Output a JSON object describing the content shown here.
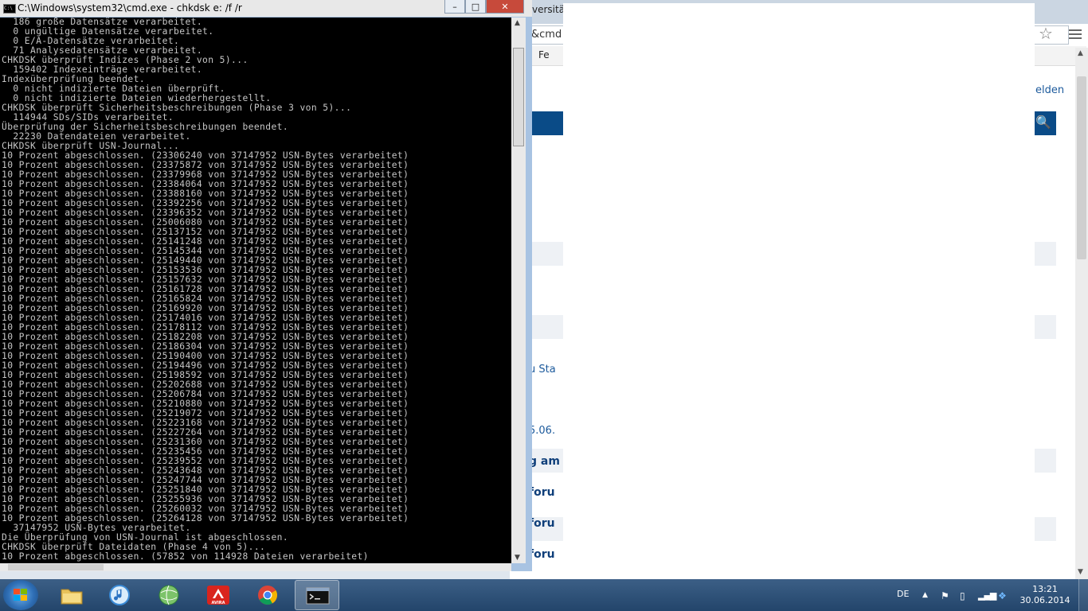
{
  "browser": {
    "tab_title_fragment": "versität",
    "address_fragment": "&cmd",
    "bookmark_fragment": "Fe",
    "login_fragment": "elden",
    "snippets": [
      "u Sta",
      "5.06.",
      "g am",
      "foru",
      "foru",
      "foru"
    ]
  },
  "cmd": {
    "title": "C:\\Windows\\system32\\cmd.exe - chkdsk  e: /f /r",
    "minimize": "–",
    "maximize": "□",
    "close": "✕",
    "lines": [
      "  186 große Datensätze verarbeitet.",
      "  0 ungültige Datensätze verarbeitet.",
      "  0 E/A-Datensätze verarbeitet.",
      "  71 Analysedatensätze verarbeitet.",
      "CHKDSK überprüft Indizes (Phase 2 von 5)...",
      "  159402 Indexeinträge verarbeitet.",
      "Indexüberprüfung beendet.",
      "  0 nicht indizierte Dateien überprüft.",
      "  0 nicht indizierte Dateien wiederhergestellt.",
      "CHKDSK überprüft Sicherheitsbeschreibungen (Phase 3 von 5)...",
      "  114944 SDs/SIDs verarbeitet.",
      "Überprüfung der Sicherheitsbeschreibungen beendet.",
      "  22230 Datendateien verarbeitet.",
      "CHKDSK überprüft USN-Journal...",
      "10 Prozent abgeschlossen. (23306240 von 37147952 USN-Bytes verarbeitet)",
      "10 Prozent abgeschlossen. (23375872 von 37147952 USN-Bytes verarbeitet)",
      "10 Prozent abgeschlossen. (23379968 von 37147952 USN-Bytes verarbeitet)",
      "10 Prozent abgeschlossen. (23384064 von 37147952 USN-Bytes verarbeitet)",
      "10 Prozent abgeschlossen. (23388160 von 37147952 USN-Bytes verarbeitet)",
      "10 Prozent abgeschlossen. (23392256 von 37147952 USN-Bytes verarbeitet)",
      "10 Prozent abgeschlossen. (23396352 von 37147952 USN-Bytes verarbeitet)",
      "10 Prozent abgeschlossen. (25006080 von 37147952 USN-Bytes verarbeitet)",
      "10 Prozent abgeschlossen. (25137152 von 37147952 USN-Bytes verarbeitet)",
      "10 Prozent abgeschlossen. (25141248 von 37147952 USN-Bytes verarbeitet)",
      "10 Prozent abgeschlossen. (25145344 von 37147952 USN-Bytes verarbeitet)",
      "10 Prozent abgeschlossen. (25149440 von 37147952 USN-Bytes verarbeitet)",
      "10 Prozent abgeschlossen. (25153536 von 37147952 USN-Bytes verarbeitet)",
      "10 Prozent abgeschlossen. (25157632 von 37147952 USN-Bytes verarbeitet)",
      "10 Prozent abgeschlossen. (25161728 von 37147952 USN-Bytes verarbeitet)",
      "10 Prozent abgeschlossen. (25165824 von 37147952 USN-Bytes verarbeitet)",
      "10 Prozent abgeschlossen. (25169920 von 37147952 USN-Bytes verarbeitet)",
      "10 Prozent abgeschlossen. (25174016 von 37147952 USN-Bytes verarbeitet)",
      "10 Prozent abgeschlossen. (25178112 von 37147952 USN-Bytes verarbeitet)",
      "10 Prozent abgeschlossen. (25182208 von 37147952 USN-Bytes verarbeitet)",
      "10 Prozent abgeschlossen. (25186304 von 37147952 USN-Bytes verarbeitet)",
      "10 Prozent abgeschlossen. (25190400 von 37147952 USN-Bytes verarbeitet)",
      "10 Prozent abgeschlossen. (25194496 von 37147952 USN-Bytes verarbeitet)",
      "10 Prozent abgeschlossen. (25198592 von 37147952 USN-Bytes verarbeitet)",
      "10 Prozent abgeschlossen. (25202688 von 37147952 USN-Bytes verarbeitet)",
      "10 Prozent abgeschlossen. (25206784 von 37147952 USN-Bytes verarbeitet)",
      "10 Prozent abgeschlossen. (25210880 von 37147952 USN-Bytes verarbeitet)",
      "10 Prozent abgeschlossen. (25219072 von 37147952 USN-Bytes verarbeitet)",
      "10 Prozent abgeschlossen. (25223168 von 37147952 USN-Bytes verarbeitet)",
      "10 Prozent abgeschlossen. (25227264 von 37147952 USN-Bytes verarbeitet)",
      "10 Prozent abgeschlossen. (25231360 von 37147952 USN-Bytes verarbeitet)",
      "10 Prozent abgeschlossen. (25235456 von 37147952 USN-Bytes verarbeitet)",
      "10 Prozent abgeschlossen. (25239552 von 37147952 USN-Bytes verarbeitet)",
      "10 Prozent abgeschlossen. (25243648 von 37147952 USN-Bytes verarbeitet)",
      "10 Prozent abgeschlossen. (25247744 von 37147952 USN-Bytes verarbeitet)",
      "10 Prozent abgeschlossen. (25251840 von 37147952 USN-Bytes verarbeitet)",
      "10 Prozent abgeschlossen. (25255936 von 37147952 USN-Bytes verarbeitet)",
      "10 Prozent abgeschlossen. (25260032 von 37147952 USN-Bytes verarbeitet)",
      "10 Prozent abgeschlossen. (25264128 von 37147952 USN-Bytes verarbeitet)",
      "  37147952 USN-Bytes verarbeitet.",
      "Die Überprüfung von USN-Journal ist abgeschlossen.",
      "CHKDSK überprüft Dateidaten (Phase 4 von 5)...",
      "10 Prozent abgeschlossen. (57852 von 114928 Dateien verarbeitet)"
    ]
  },
  "taskbar": {
    "apps": [
      {
        "name": "explorer",
        "icon": "folder-icon"
      },
      {
        "name": "itunes",
        "icon": "itunes-icon"
      },
      {
        "name": "network",
        "icon": "globe-icon"
      },
      {
        "name": "avira",
        "icon": "avira-icon",
        "label": "AVIRA"
      },
      {
        "name": "chrome",
        "icon": "chrome-icon"
      },
      {
        "name": "cmd",
        "icon": "cmd-icon",
        "active": true
      }
    ],
    "language": "DE",
    "time": "13:21",
    "date": "30.06.2014"
  },
  "colors": {
    "console_bg": "#000000",
    "console_text": "#c6c6c6",
    "close_red": "#c74a3b",
    "taskbar": "#2d5078",
    "browser_nav": "#0a4b87"
  }
}
